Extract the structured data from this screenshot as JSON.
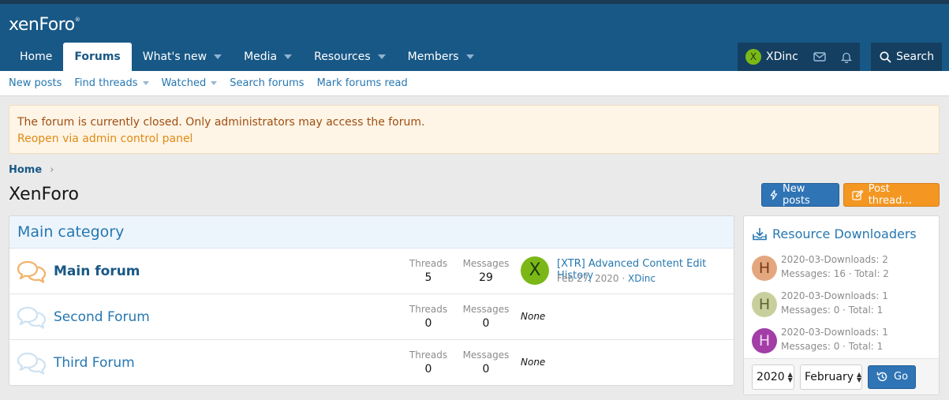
{
  "header": {
    "logo": "xenForo",
    "logo_mark": "®",
    "nav": [
      {
        "label": "Home",
        "active": false,
        "dropdown": false
      },
      {
        "label": "Forums",
        "active": true,
        "dropdown": false
      },
      {
        "label": "What's new",
        "active": false,
        "dropdown": true
      },
      {
        "label": "Media",
        "active": false,
        "dropdown": true
      },
      {
        "label": "Resources",
        "active": false,
        "dropdown": true
      },
      {
        "label": "Members",
        "active": false,
        "dropdown": true
      }
    ],
    "user": {
      "initial": "X",
      "name": "XDinc"
    },
    "search_label": "Search"
  },
  "subnav": [
    {
      "label": "New posts",
      "dropdown": false
    },
    {
      "label": "Find threads",
      "dropdown": true
    },
    {
      "label": "Watched",
      "dropdown": true
    },
    {
      "label": "Search forums",
      "dropdown": false
    },
    {
      "label": "Mark forums read",
      "dropdown": false
    }
  ],
  "notice": {
    "text": "The forum is currently closed. Only administrators may access the forum.",
    "link": "Reopen via admin control panel"
  },
  "breadcrumb": {
    "home": "Home",
    "separator": "›"
  },
  "page": {
    "title": "XenForo",
    "new_posts_label": "New posts",
    "post_thread_label": "Post thread..."
  },
  "category": {
    "title": "Main category",
    "forums": [
      {
        "title": "Main forum",
        "unread": true,
        "threads_label": "Threads",
        "threads": "5",
        "messages_label": "Messages",
        "messages": "29",
        "latest": {
          "avatar": "X",
          "title": "[XTR] Advanced Content Edit History",
          "date": "Feb 27, 2020",
          "sep": "·",
          "user": "XDinc"
        }
      },
      {
        "title": "Second Forum",
        "unread": false,
        "threads_label": "Threads",
        "threads": "0",
        "messages_label": "Messages",
        "messages": "0",
        "none": "None"
      },
      {
        "title": "Third Forum",
        "unread": false,
        "threads_label": "Threads",
        "threads": "0",
        "messages_label": "Messages",
        "messages": "0",
        "none": "None"
      }
    ]
  },
  "sidebar": {
    "title": "Resource Downloaders",
    "items": [
      {
        "initial": "H",
        "color": "#e3a77f",
        "line1": "2020-03-Downloads: 2",
        "line2": "Messages: 16 · Total: 2"
      },
      {
        "initial": "H",
        "color": "#c8cf9d",
        "line1": "2020-03-Downloads: 1",
        "line2": "Messages: 0 · Total: 1"
      },
      {
        "initial": "H",
        "color": "#a23ea6",
        "line1": "2020-03-Downloads: 1",
        "line2": "Messages: 0 · Total: 1"
      }
    ],
    "year": "2020",
    "month": "February",
    "go_label": "Go"
  },
  "colors": {
    "header": "#185886",
    "accent": "#2577b1",
    "post_button": "#f39722"
  }
}
